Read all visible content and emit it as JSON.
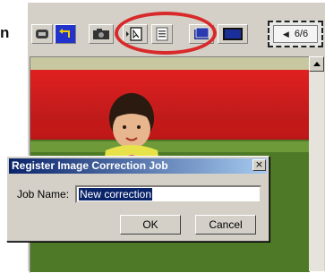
{
  "callout": {
    "label": "n"
  },
  "toolbar": {
    "buttons": [
      {
        "name": "back-button",
        "icon": "screen-icon"
      },
      {
        "name": "undo-button",
        "icon": "undo-icon"
      },
      {
        "name": "snapshot-button",
        "icon": "camera-icon"
      },
      {
        "name": "register-correction-button",
        "icon": "register-icon"
      },
      {
        "name": "correction-list-button",
        "icon": "list-icon"
      },
      {
        "name": "compare-view-button",
        "icon": "compare-icon"
      },
      {
        "name": "full-view-button",
        "icon": "monitor-icon"
      }
    ],
    "frame_counter": "6/6"
  },
  "dialog": {
    "title": "Register Image Correction Job",
    "close_label": "×",
    "job_name_label": "Job Name:",
    "job_name_value": "New correction",
    "ok_label": "OK",
    "cancel_label": "Cancel"
  },
  "colors": {
    "window_bg": "#d4d0c8",
    "titlebar": "#0a246a",
    "highlight_ring": "#d82a2a"
  }
}
